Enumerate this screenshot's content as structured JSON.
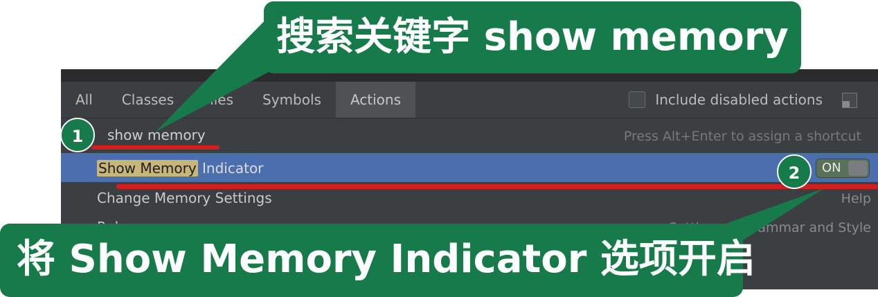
{
  "tabs": [
    {
      "label": "All"
    },
    {
      "label": "Classes"
    },
    {
      "label": "Files"
    },
    {
      "label": "Symbols"
    },
    {
      "label": "Actions",
      "active": true
    }
  ],
  "include_disabled": {
    "label": "Include disabled actions",
    "checked": false
  },
  "search": {
    "value": "show memory",
    "hint": "Press Alt+Enter to assign a shortcut"
  },
  "results": [
    {
      "match": "Show Memory",
      "rest": " Indicator",
      "toggle": "ON",
      "selected": true
    },
    {
      "label": "Change Memory Settings",
      "right": "Help"
    },
    {
      "label": "Rules:",
      "right": "Settings > Grammar and Style"
    }
  ],
  "annotations": {
    "badge1": "1",
    "badge2": "2",
    "callout_top": "搜索关键字 show memory",
    "callout_bottom": "将 Show Memory Indicator 选项开启"
  },
  "colors": {
    "callout_green": "#167a4a",
    "underline_red": "#d01f1f",
    "selection_blue": "#4b6eaf"
  }
}
